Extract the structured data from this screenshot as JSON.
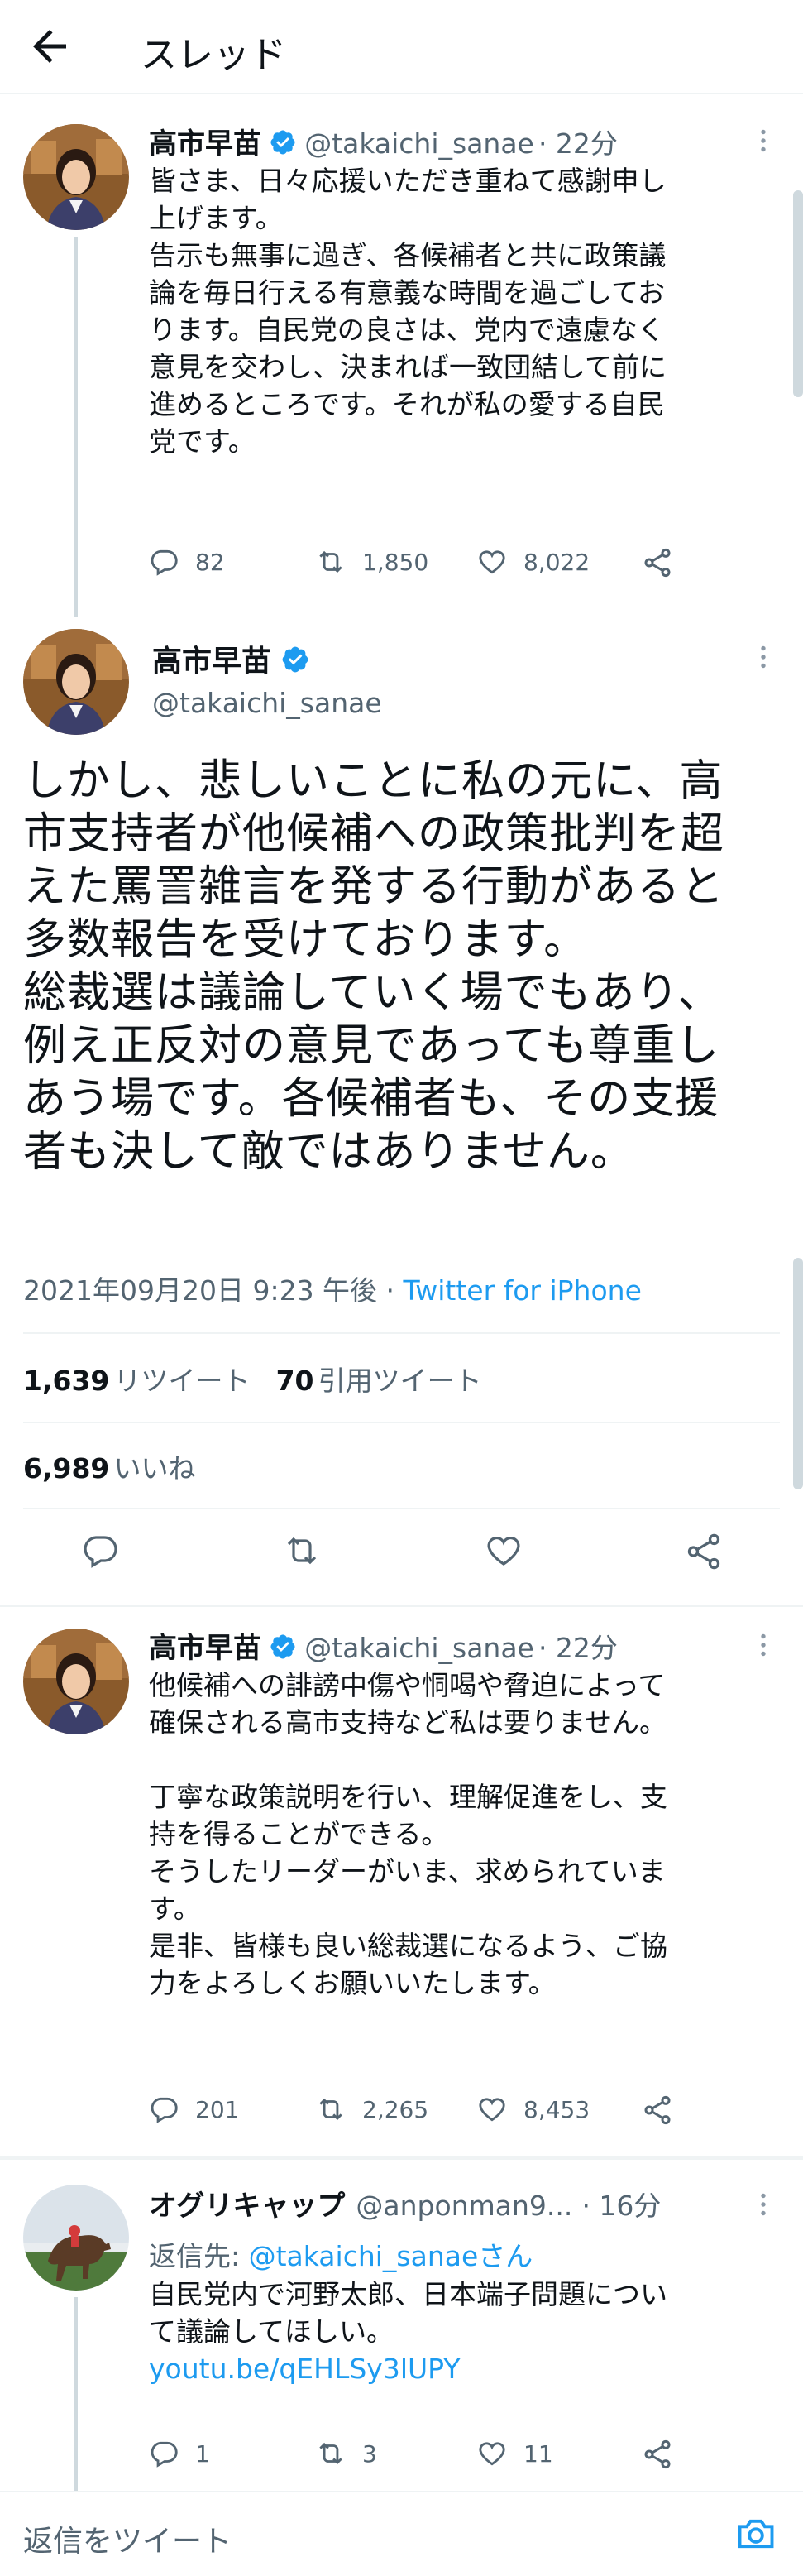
{
  "header": {
    "title": "スレッド"
  },
  "tweets": [
    {
      "name": "高市早苗",
      "handle": "@takaichi_sanae",
      "time": "· 22分",
      "lines": [
        "皆さま、日々応援いただき重ねて感謝申し",
        "上げます。",
        "告示も無事に過ぎ、各候補者と共に政策議",
        "論を毎日行える有意義な時間を過ごしてお",
        "ります。自民党の良さは、党内で遠慮なく",
        "意見を交わし、決まれば一致団結して前に",
        "進めるところです。それが私の愛する自民",
        "党です。"
      ],
      "replies": "82",
      "retweets": "1,850",
      "likes": "8,022"
    }
  ],
  "main_tweet": {
    "name": "高市早苗",
    "handle": "@takaichi_sanae",
    "lines": [
      "しかし、悲しいことに私の元に、高",
      "市支持者が他候補への政策批判を超",
      "えた罵詈雑言を発する行動があると",
      "多数報告を受けております。",
      "総裁選は議論していく場でもあり、",
      "例え正反対の意見であっても尊重し",
      "あう場です。各候補者も、その支援",
      "者も決して敵ではありません。"
    ],
    "datetime": "2021年09月20日 9:23 午後 · ",
    "source": "Twitter for iPhone",
    "retweet_count": "1,639",
    "retweet_label": "リツイート",
    "quote_count": "70",
    "quote_label": "引用ツイート",
    "like_count": "6,989",
    "like_label": "いいね"
  },
  "reply_tweet": {
    "name": "高市早苗",
    "handle": "@takaichi_sanae",
    "time": "· 22分",
    "lines": [
      "他候補への誹謗中傷や恫喝や脅迫によって",
      "確保される高市支持など私は要りません。",
      "",
      "丁寧な政策説明を行い、理解促進をし、支",
      "持を得ることができる。",
      "そうしたリーダーがいま、求められていま",
      "す。",
      "是非、皆様も良い総裁選になるよう、ご協",
      "力をよろしくお願いいたします。"
    ],
    "replies": "201",
    "retweets": "2,265",
    "likes": "8,453"
  },
  "other_tweet": {
    "name": "オグリキャップ",
    "handle": "@anponman9...",
    "time": "· 16分",
    "reply_to_label": "返信先: ",
    "reply_to_handle": "@takaichi_sanaeさん",
    "lines": [
      "自民党内で河野太郎、日本端子問題につい",
      "て議論してほしい。"
    ],
    "link": "youtu.be/qEHLSy3lUPY",
    "replies": "1",
    "retweets": "3",
    "likes": "11"
  },
  "compose": {
    "placeholder": "返信をツイート"
  },
  "colors": {
    "accent": "#1d9bf0",
    "text": "#0f1419",
    "muted": "#536471",
    "divider": "#eff3f4"
  }
}
